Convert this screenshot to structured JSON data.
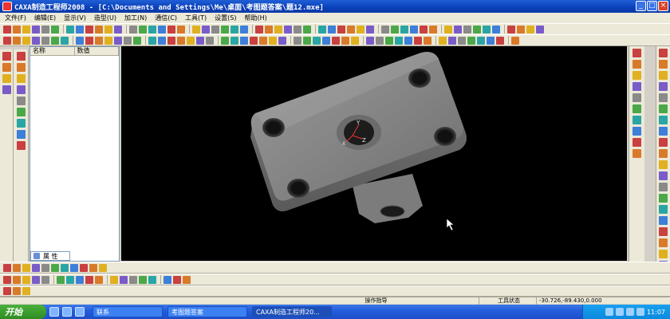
{
  "window": {
    "title": "CAXA制造工程师2008   - [C:\\Documents and Settings\\Me\\桌面\\考图题答案\\题12.mxe]",
    "min_label": "_",
    "max_label": "□",
    "close_label": "×"
  },
  "menu": [
    "文件(F)",
    "编辑(E)",
    "显示(V)",
    "造型(U)",
    "加工(N)",
    "通信(C)",
    "工具(T)",
    "设置(S)",
    "帮助(H)"
  ],
  "tree": {
    "col_name": "名称",
    "col_value": "数值",
    "tab_label": "属 性"
  },
  "viewport": {
    "axis_label": "Z",
    "axis_y": "Y",
    "axis_x": "X"
  },
  "status": {
    "hint": "操作指导",
    "tool_state": "工具状态",
    "coords": "-30.726,-89.430,0.000"
  },
  "taskbar": {
    "start_label": "开始",
    "tasks": [
      "联系",
      "考图题答案",
      "CAXA制造工程师20..."
    ],
    "time": "11:07"
  },
  "colors": {
    "titlebar": "#0a3fb8",
    "viewport_bg": "#000000",
    "part": "#8c8c8c"
  }
}
